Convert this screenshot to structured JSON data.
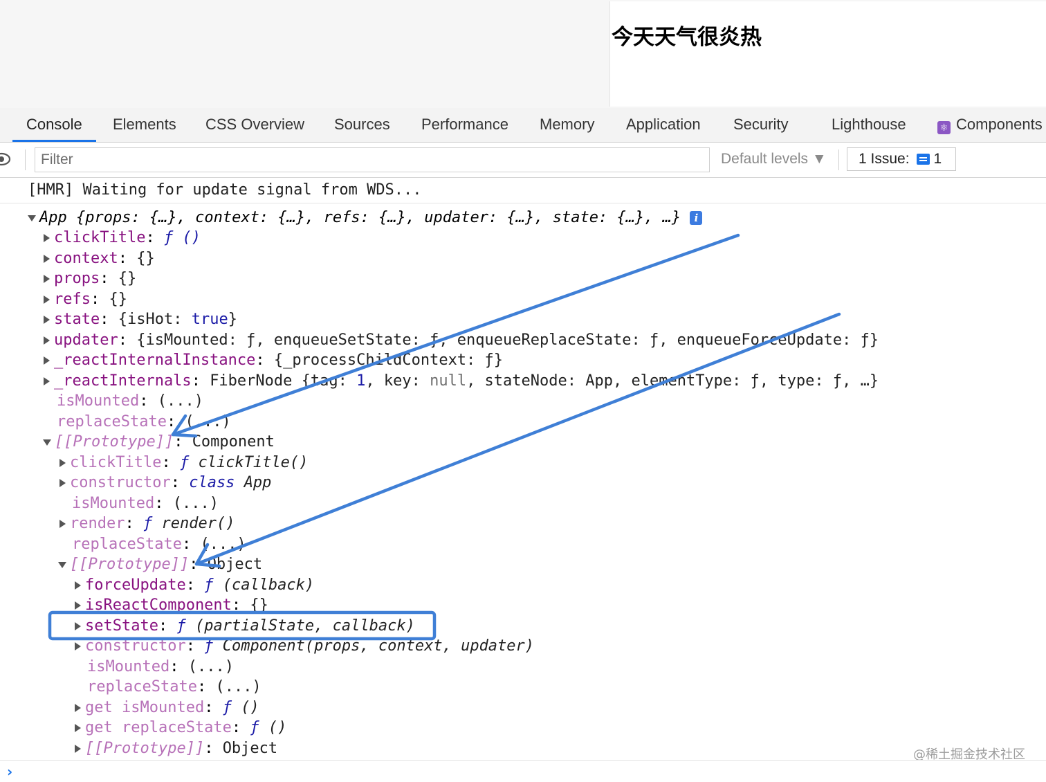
{
  "page": {
    "heading": "今天天气很炎热"
  },
  "tabs": [
    "Console",
    "Elements",
    "CSS Overview",
    "Sources",
    "Performance",
    "Memory",
    "Application",
    "Security",
    "Lighthouse",
    "Components"
  ],
  "toolbar": {
    "filter_placeholder": "Filter",
    "levels_label": "Default levels ▼",
    "issues_label": "1 Issue:",
    "issues_count": "1"
  },
  "console": {
    "hmr": "[HMR] Waiting for update signal from WDS...",
    "summary": "App {props: {…}, context: {…}, refs: {…}, updater: {…}, state: {…}, …}",
    "info_badge": "i",
    "l1": {
      "key": "clickTitle",
      "val": "ƒ ()"
    },
    "l2": {
      "key": "context",
      "val": "{}"
    },
    "l3": {
      "key": "props",
      "val": "{}"
    },
    "l4": {
      "key": "refs",
      "val": "{}"
    },
    "l5": {
      "key": "state",
      "pre": "{isHot: ",
      "val": "true",
      "post": "}"
    },
    "l6": {
      "key": "updater",
      "val": "{isMounted: ƒ, enqueueSetState: ƒ, enqueueReplaceState: ƒ, enqueueForceUpdate: ƒ}"
    },
    "l7": {
      "key": "_reactInternalInstance",
      "val": "{_processChildContext: ƒ}"
    },
    "l8": {
      "key": "_reactInternals",
      "pre": "FiberNode {tag: ",
      "n": "1",
      "mid": ", key: ",
      "nul": "null",
      "post": ", stateNode: App, elementType: ƒ, type: ƒ, …}"
    },
    "l9": {
      "key": "isMounted",
      "val": "(...)"
    },
    "l10": {
      "key": "replaceState",
      "val": "(...)"
    },
    "l11": {
      "key": "[[Prototype]]",
      "val": "Component"
    },
    "l12": {
      "key": "clickTitle",
      "f": "ƒ",
      "val": "clickTitle()"
    },
    "l13": {
      "key": "constructor",
      "kw": "class",
      "val": "App"
    },
    "l14": {
      "key": "isMounted",
      "val": "(...)"
    },
    "l15": {
      "key": "render",
      "f": "ƒ",
      "val": "render()"
    },
    "l16": {
      "key": "replaceState",
      "val": "(...)"
    },
    "l17": {
      "key": "[[Prototype]]",
      "val": "Object"
    },
    "l18": {
      "key": "forceUpdate",
      "f": "ƒ",
      "val": "(callback)"
    },
    "l19": {
      "key": "isReactComponent",
      "val": "{}"
    },
    "l20": {
      "key": "setState",
      "f": "ƒ",
      "val": "(partialState, callback)"
    },
    "l21": {
      "key": "constructor",
      "f": "ƒ",
      "val": "Component(props, context, updater)"
    },
    "l22": {
      "key": "isMounted",
      "val": "(...)"
    },
    "l23": {
      "key": "replaceState",
      "val": "(...)"
    },
    "l24": {
      "key": "get isMounted",
      "f": "ƒ",
      "val": "()"
    },
    "l25": {
      "key": "get replaceState",
      "f": "ƒ",
      "val": "()"
    },
    "l26": {
      "key": "[[Prototype]]",
      "val": "Object"
    },
    "prompt": "›"
  },
  "watermark": "@稀土掘金技术社区",
  "colors": {
    "accent": "#1a73e8",
    "annotation": "#3f7fd6",
    "property": "#881280"
  }
}
